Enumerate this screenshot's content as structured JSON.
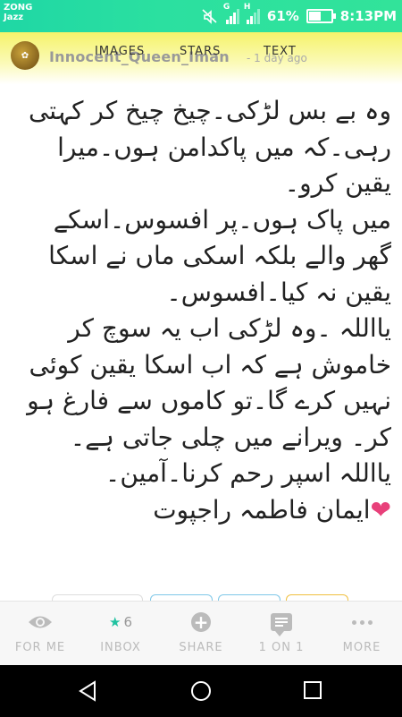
{
  "status_bar": {
    "carrier_line1": "ZONG",
    "carrier_line2": "Jazz",
    "signal1_label": "G",
    "signal2_label": "H",
    "battery_percent": "61%",
    "battery_level": 0.61,
    "time": "8:13PM"
  },
  "header": {
    "author": "Innocent_Queen_Iman",
    "time_ago": "- 1 day ago",
    "tabs": [
      {
        "label": "IMAGES"
      },
      {
        "label": "STARS"
      },
      {
        "label": "TEXT"
      }
    ]
  },
  "content": {
    "lines": [
      "وہ بے بس لڑکی۔چیخ چیخ کر کہتی",
      "رہی۔کہ میں پاکدامن ہوں۔میرا",
      "یقین کرو۔",
      "میں پاک ہوں۔پر افسوس۔اسکے",
      "گھر والے بلکہ اسکی ماں نے اسکا",
      "یقین نہ کیا۔افسوس۔",
      "یااللہ ۔وہ لڑکی اب یہ سوچ کر",
      "خاموش ہے کہ اب اسکا یقین کوئی",
      "نہیں کرے گا۔تو کاموں سے فارغ ہو",
      "کر۔ ویرانے میں چلی جاتی ہے۔",
      "یااللہ اسپر رحم کرنا۔آمین۔"
    ],
    "signature": "ایمان فاطمہ راجپوت",
    "heart_icon": "heart-icon",
    "heart_color": "#e8407a"
  },
  "bottom_nav": {
    "items": [
      {
        "label": "FOR ME",
        "icon": "eye-icon"
      },
      {
        "label": "INBOX",
        "icon": "star-icon",
        "count": "6"
      },
      {
        "label": "SHARE",
        "icon": "plus-circle-icon"
      },
      {
        "label": "1 ON 1",
        "icon": "chat-icon"
      },
      {
        "label": "MORE",
        "icon": "more-dots-icon"
      }
    ]
  },
  "colors": {
    "status_bar": "#2be0a0",
    "header": "#f5f36a",
    "inbox_star": "#1fc2a0"
  }
}
